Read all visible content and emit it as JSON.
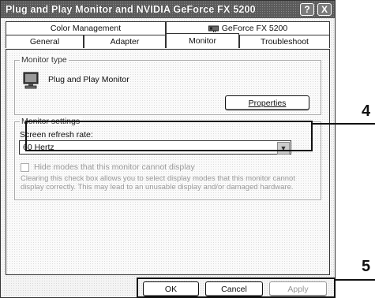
{
  "window": {
    "title": "Plug and Play Monitor and NVIDIA GeForce FX 5200",
    "help_label": "?",
    "close_label": "X"
  },
  "tabs_row1": [
    {
      "label": "Color Management"
    },
    {
      "label": "GeForce FX 5200",
      "icon": "nvidia-card-icon"
    }
  ],
  "tabs_row2": [
    {
      "label": "General"
    },
    {
      "label": "Adapter"
    },
    {
      "label": "Monitor",
      "active": true
    },
    {
      "label": "Troubleshoot"
    }
  ],
  "monitor_type": {
    "legend": "Monitor type",
    "name": "Plug and Play Monitor",
    "properties_button": "Properties"
  },
  "monitor_settings": {
    "legend": "Monitor settings",
    "refresh_label": "Screen refresh rate:",
    "refresh_value": "60 Hertz",
    "hide_modes_label": "Hide modes that this monitor cannot display",
    "hide_modes_checked": false,
    "description": "Clearing this check box allows you to select display modes that this monitor cannot display correctly. This may lead to an unusable display and/or damaged hardware."
  },
  "buttons": {
    "ok": "OK",
    "cancel": "Cancel",
    "apply": "Apply"
  },
  "callouts": {
    "refresh_rate": "4",
    "buttons": "5"
  }
}
